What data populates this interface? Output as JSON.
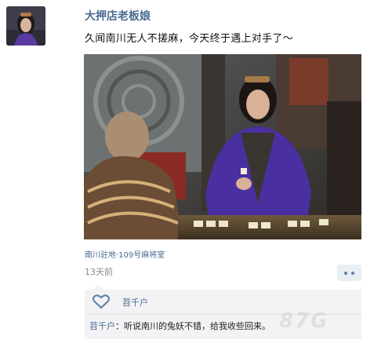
{
  "post": {
    "username": "大押店老板娘",
    "text": "久闻南川无人不搓麻，今天终于遇上对手了～",
    "location": "南川驻地·109号麻将室",
    "time": "13天前"
  },
  "likes": {
    "names": "苕千户"
  },
  "comments": [
    {
      "author": "苕千户",
      "separator": "：",
      "text": "听说南川的兔妖不错，给我收些回来。"
    }
  ],
  "watermark": "87G",
  "icons": {
    "heart": "heart-icon",
    "comment": "comment-icon"
  },
  "colors": {
    "link": "#4a6b93",
    "panel": "#f3f3f5"
  }
}
